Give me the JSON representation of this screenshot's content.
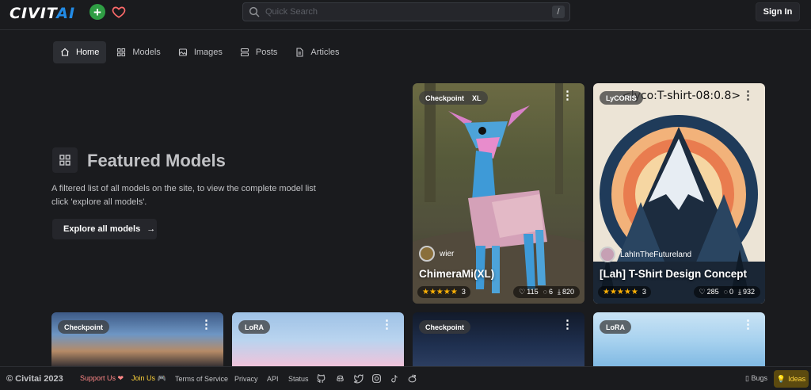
{
  "header": {
    "logo_main": "CIVIT",
    "logo_accent": "AI",
    "search_placeholder": "Quick Search",
    "search_shortcut": "/",
    "signin_label": "Sign In"
  },
  "nav": {
    "items": [
      {
        "label": "Home",
        "icon": "home-icon",
        "active": true
      },
      {
        "label": "Models",
        "icon": "grid-icon"
      },
      {
        "label": "Images",
        "icon": "photo-icon"
      },
      {
        "label": "Posts",
        "icon": "posts-icon"
      },
      {
        "label": "Articles",
        "icon": "article-icon"
      }
    ]
  },
  "featured": {
    "title": "Featured Models",
    "description": "A filtered list of all models on the site, to view the complete model list click 'explore all models'.",
    "explore_label": "Explore all models"
  },
  "cards": [
    {
      "badge": "Checkpoint",
      "badge2": "XL",
      "creator": "wier",
      "title": "ChimeraMi(XL)",
      "rating_count": "3",
      "likes": "115",
      "comments": "6",
      "downloads": "820"
    },
    {
      "badge": "LyCORIS",
      "overlay_text": "<lyco:T-shirt-08:0.8>",
      "creator": "LahInTheFutureland",
      "title": "[Lah] T-Shirt Design Concept",
      "rating_count": "3",
      "likes": "285",
      "comments": "0",
      "downloads": "932"
    }
  ],
  "bottom_cards": [
    {
      "badge": "Checkpoint"
    },
    {
      "badge": "LoRA"
    },
    {
      "badge": "Checkpoint"
    },
    {
      "badge": "LoRA"
    }
  ],
  "footer": {
    "copyright": "© Civitai 2023",
    "support": "Support Us ❤",
    "join": "Join Us 🎮",
    "terms": "Terms of Service",
    "privacy": "Privacy",
    "api": "API",
    "status": "Status",
    "bugs": "Bugs",
    "ideas": "Ideas"
  },
  "colors": {
    "background": "#1a1b1e",
    "accent_blue": "#228be6",
    "plus_green": "#2f9e44",
    "star": "#fab005"
  }
}
